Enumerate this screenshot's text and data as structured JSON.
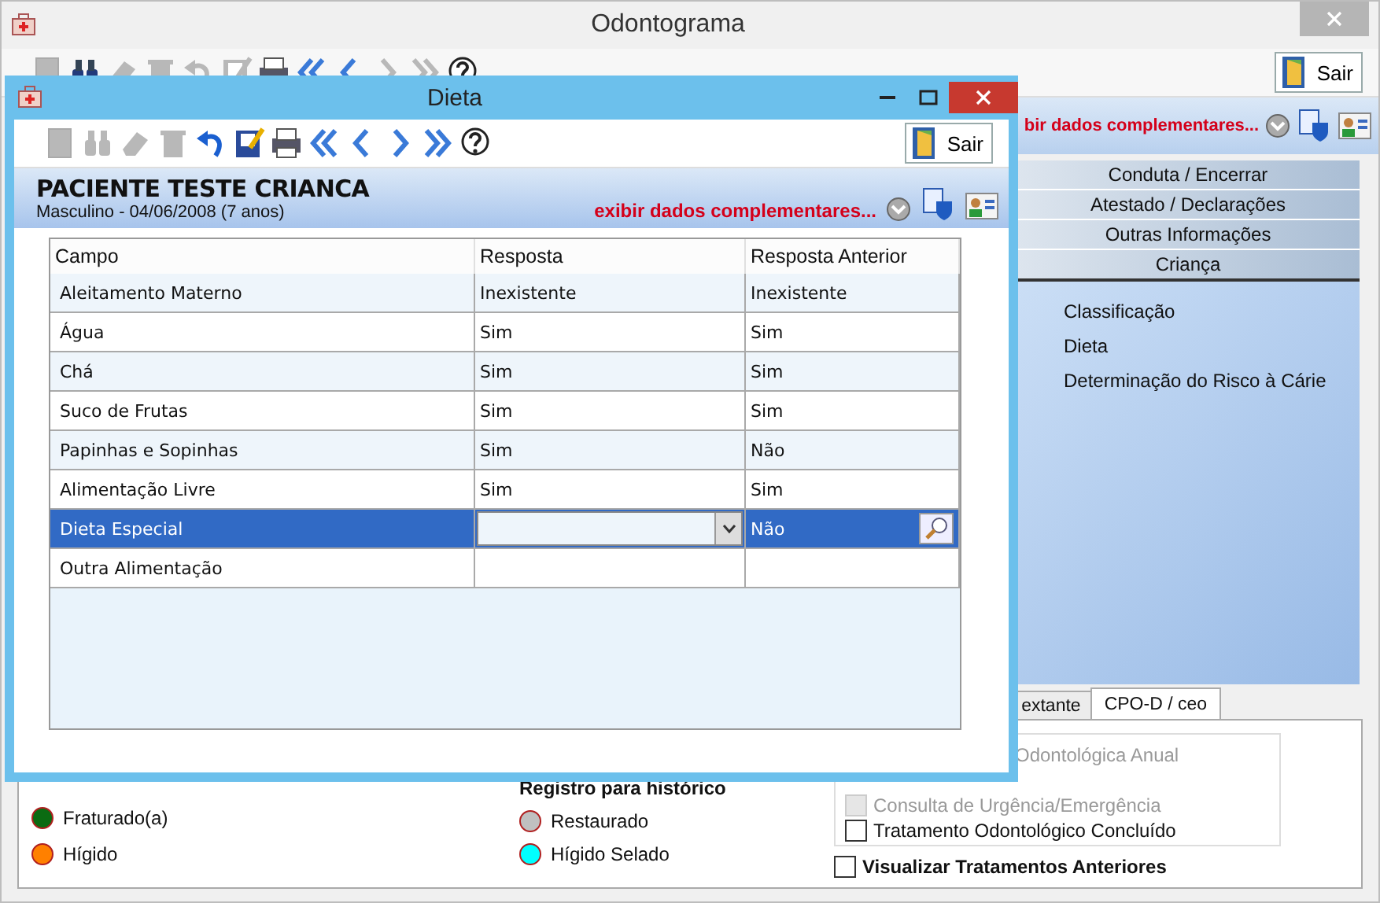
{
  "window": {
    "title": "Odontograma"
  },
  "toolbar": {
    "buttons": [
      {
        "kind": "new",
        "disabled": true
      },
      {
        "kind": "find",
        "disabled": false
      },
      {
        "kind": "erase",
        "disabled": true
      },
      {
        "kind": "delete",
        "disabled": true
      },
      {
        "kind": "undo",
        "disabled": true
      },
      {
        "kind": "save",
        "disabled": true
      },
      {
        "kind": "print",
        "disabled": false
      },
      {
        "kind": "first",
        "disabled": false
      },
      {
        "kind": "prev",
        "disabled": false
      },
      {
        "kind": "next",
        "disabled": true
      },
      {
        "kind": "last",
        "disabled": true
      },
      {
        "kind": "help",
        "disabled": false
      }
    ],
    "exit": "Sair"
  },
  "header": {
    "more_link": "bir dados complementares..."
  },
  "side_panel": {
    "sections": [
      {
        "label": "Conduta / Encerrar",
        "selected": false
      },
      {
        "label": "Atestado / Declarações",
        "selected": false
      },
      {
        "label": "Outras Informações",
        "selected": false
      },
      {
        "label": "Criança",
        "selected": true
      }
    ],
    "items": [
      "Classificação",
      "Dieta",
      "Determinação do Risco à Cárie"
    ]
  },
  "tabs": [
    {
      "label": "extante",
      "selected": false
    },
    {
      "label": "CPO-D / ceo",
      "selected": true
    }
  ],
  "legend": {
    "column_1": [
      {
        "label": "Fraturado(a)",
        "color": "#0b6b12"
      },
      {
        "label": "Hígido",
        "color": "#ff8000"
      }
    ],
    "history_title": "Registro para histórico",
    "column_2": [
      {
        "label": "Restaurado",
        "color": "#c0c0c0"
      },
      {
        "label": "Hígido Selado",
        "color": "#00ffff"
      }
    ]
  },
  "options": [
    {
      "label": "Odontológica Anual",
      "kind": "text",
      "disabled": true
    },
    {
      "label": "Consulta de Urgência/Emergência",
      "kind": "checkbox",
      "checked": false,
      "disabled": true
    },
    {
      "label": "Tratamento Odontológico Concluído",
      "kind": "checkbox",
      "checked": false,
      "disabled": false
    }
  ],
  "show_previous": {
    "label": "Visualizar Tratamentos Anteriores",
    "checked": false
  },
  "dialog": {
    "title": "Dieta",
    "toolbar": {
      "buttons": [
        {
          "kind": "new",
          "disabled": true
        },
        {
          "kind": "find",
          "disabled": true
        },
        {
          "kind": "erase",
          "disabled": true
        },
        {
          "kind": "delete",
          "disabled": true
        },
        {
          "kind": "undo",
          "disabled": false
        },
        {
          "kind": "save",
          "disabled": false
        },
        {
          "kind": "print",
          "disabled": false
        },
        {
          "kind": "first",
          "disabled": false
        },
        {
          "kind": "prev",
          "disabled": false
        },
        {
          "kind": "next",
          "disabled": false
        },
        {
          "kind": "last",
          "disabled": false
        },
        {
          "kind": "help",
          "disabled": false
        }
      ],
      "exit": "Sair"
    },
    "patient": {
      "name": "PACIENTE TESTE CRIANCA",
      "details": "Masculino - 04/06/2008 (7 anos)",
      "more_link": "exibir dados complementares..."
    },
    "table": {
      "columns": [
        "Campo",
        "Resposta",
        "Resposta Anterior"
      ],
      "rows": [
        {
          "field": "Aleitamento Materno",
          "answer": "Inexistente",
          "previous": "Inexistente",
          "selected": false,
          "kind": "text"
        },
        {
          "field": "Água",
          "answer": "Sim",
          "previous": "Sim",
          "selected": false,
          "kind": "text"
        },
        {
          "field": "Chá",
          "answer": "Sim",
          "previous": "Sim",
          "selected": false,
          "kind": "text"
        },
        {
          "field": "Suco de Frutas",
          "answer": "Sim",
          "previous": "Sim",
          "selected": false,
          "kind": "text"
        },
        {
          "field": "Papinhas e Sopinhas",
          "answer": "Sim",
          "previous": "Não",
          "selected": false,
          "kind": "text"
        },
        {
          "field": "Alimentação Livre",
          "answer": "Sim",
          "previous": "Sim",
          "selected": false,
          "kind": "text"
        },
        {
          "field": "Dieta Especial",
          "previous": "Não",
          "selected": true,
          "kind": "dropdown"
        },
        {
          "field": "Outra Alimentação",
          "selected": false,
          "kind": "text"
        }
      ]
    }
  }
}
